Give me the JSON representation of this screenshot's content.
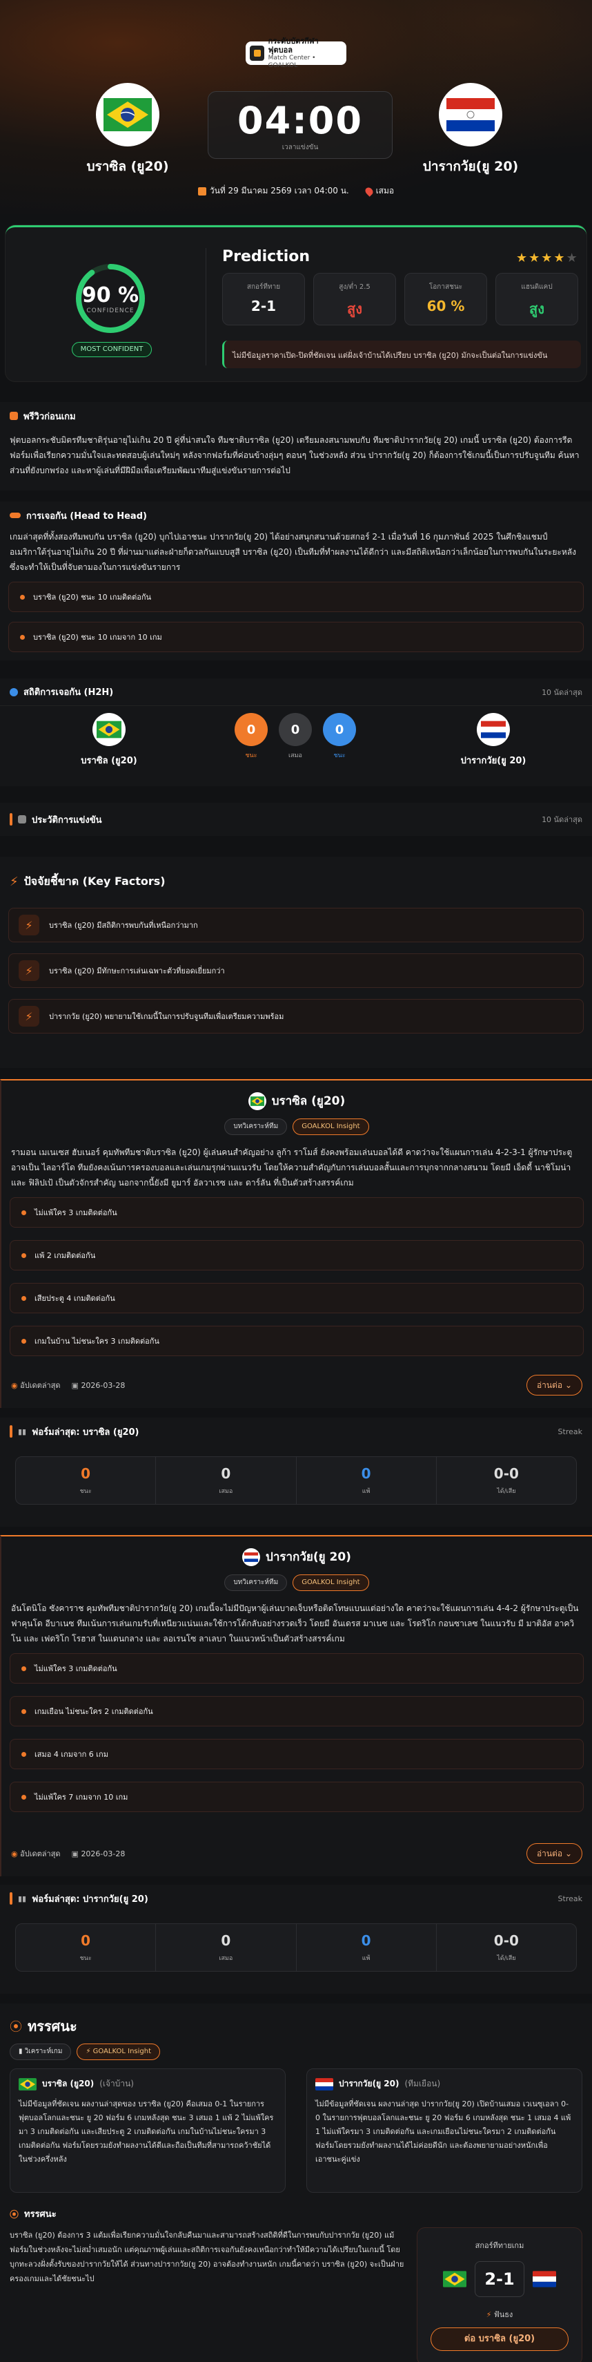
{
  "header": {
    "site_title": "กระดับบัตรกีฬาฟุตบอล",
    "site_subtitle": "Match Center • GOALKOL"
  },
  "match": {
    "home_team": "บราซิล (ยู20)",
    "away_team": "ปารากวัย(ยู 20)",
    "kickoff_time": "04:00",
    "time_label": "เวลาแข่งขัน",
    "date_text": "วันที่ 29 มีนาคม 2569 เวลา 04:00 น.",
    "venue_text": "เสมอ"
  },
  "prediction": {
    "confidence": "90 %",
    "confidence_value": 90,
    "confidence_label": "CONFIDENCE",
    "badge": "MOST CONFIDENT",
    "title": "Prediction",
    "stars": 4,
    "stars_max": 5,
    "cards": [
      {
        "label": "สกอร์ทีทาย",
        "value": "2-1",
        "color": "white"
      },
      {
        "label": "สูง/ต่ำ 2.5",
        "value": "สูง",
        "color": "red"
      },
      {
        "label": "โอกาสชนะ",
        "value": "60 %",
        "color": "gold"
      },
      {
        "label": "แฮนดิแคป",
        "value": "สูง",
        "color": "green"
      }
    ],
    "note": "ไม่มีข้อมูลราคาเปิด-ปิดที่ชัดเจน แต่ฝั่งเจ้าบ้านได้เปรียบ บราซิล (ยู20) มักจะเป็นต่อในการแข่งขัน"
  },
  "preview": {
    "title": "พรีวิวก่อนเกม",
    "text": "ฟุตบอลกระชับมิตรทีมชาติรุ่นอายุไม่เกิน 20 ปี คู่ที่น่าสนใจ ทีมชาติบราซิล (ยู20) เตรียมลงสนามพบกับ ทีมชาติปารากวัย(ยู 20) เกมนี้ บราซิล (ยู20) ต้องการรีดฟอร์มเพื่อเรียกความมั่นใจและทดสอบผู้เล่นใหม่ๆ หลังจากฟอร์มที่ค่อนข้างลุ่มๆ ดอนๆ ในช่วงหลัง ส่วน ปารากวัย(ยู 20) ก็ต้องการใช้เกมนี้เป็นการปรับจูนทีม ค้นหาส่วนที่ยังบกพร่อง และหาผู้เล่นที่มีฝีมือเพื่อเตรียมพัฒนาทีมสู่แข่งขันรายการต่อไป"
  },
  "h2h_text": {
    "title": "การเจอกัน (Head to Head)",
    "text": "เกมล่าสุดที่ทั้งสองทีมพบกัน บราซิล (ยู20) บุกไปเอาชนะ ปารากวัย(ยู 20) ได้อย่างสนุกสนานด้วยสกอร์ 2-1 เมื่อวันที่ 16 กุมภาพันธ์ 2025 ในศึกชิงแชมป์อเมริกาใต้รุ่นอายุไม่เกิน 20 ปี ที่ผ่านมาแต่ละฝ่ายก็ดวลกันแบบสูสี บราซิล (ยู20) เป็นทีมที่ทำผลงานได้ดีกว่า และมีสถิติเหนือกว่าเล็กน้อยในการพบกันในระยะหลัง ซึ่งจะทำให้เป็นที่จับตามองในการแข่งขันรายการ",
    "items": [
      "บราซิล (ยู20) ชนะ 10 เกมติดต่อกัน",
      "บราซิล (ยู20) ชนะ 10 เกมจาก 10 เกม"
    ]
  },
  "h2h_stats": {
    "title": "สถิติการเจอกัน (H2H)",
    "count_label": "10 นัดล่าสุด",
    "home_name": "บราซิล (ยู20)",
    "away_name": "ปารากวัย(ยู 20)",
    "circles": [
      {
        "value": "0",
        "label": "ชนะ"
      },
      {
        "value": "0",
        "label": "เสมอ"
      },
      {
        "value": "0",
        "label": "ชนะ"
      }
    ]
  },
  "history": {
    "title": "ประวัติการแข่งขัน",
    "count_label": "10 นัดล่าสุด"
  },
  "key_factors": {
    "title": "ปัจจัยชี้ขาด (Key Factors)",
    "items": [
      "บราซิล (ยู20) มีสถิติการพบกันที่เหนือกว่ามาก",
      "บราซิล (ยู20) มีทักษะการเล่นเฉพาะตัวที่ยอดเยี่ยมกว่า",
      "ปารากวัย (ยู20) พยายามใช้เกมนี้ในการปรับจูนทีมเพื่อเตรียมความพร้อม"
    ]
  },
  "home_analysis": {
    "name": "บราซิล (ยู20)",
    "pill_1": "บทวิเคราะห์ทีม",
    "pill_2": "GOALKOL Insight",
    "text": "รามอน เมเนเซส ฮับเนอร์ คุมทัพทีมชาติบราซิล (ยู20) ผู้เล่นคนสำคัญอย่าง ลูก้า ราโมส์ ยังคงพร้อมเล่นบอลได้ดี คาดว่าจะใช้แผนการเล่น 4-2-3-1 ผู้รักษาประตูอาจเป็น ไลอาร์โด ทีมยังคงเน้นการครองบอลและเล่นเกมรุกผ่านแนวรับ โดยให้ความสำคัญกับการเล่นบอลสั้นและการบุกจากกลางสนาม โดยมี เอ็ดดี้ นาชิโมน่า และ ฟิลิปเป้ เป็นตัวจักรสำคัญ นอกจากนี้ยังมี ยูมาร์ อัลวาเรซ และ ดาร์ลัน ที่เป็นตัวสร้างสรรค์เกม",
    "items": [
      "ไม่แพ้ใคร 3 เกมติดต่อกัน",
      "แพ้ 2 เกมติดต่อกัน",
      "เสียประตู 4 เกมติดต่อกัน",
      "เกมในบ้าน ไม่ชนะใคร 3 เกมติดต่อกัน"
    ],
    "updated_label": "อัปเดตล่าสุด",
    "updated_date": "2026-03-28",
    "readmore": "อ่านต่อ"
  },
  "home_form": {
    "title": "ฟอร์มล่าสุด: บราซิล (ยู20)",
    "right": "Streak",
    "cells": [
      {
        "value": "0",
        "label": "ชนะ"
      },
      {
        "value": "0",
        "label": "เสมอ"
      },
      {
        "value": "0",
        "label": "แพ้"
      },
      {
        "value": "0-0",
        "label": "ได้/เสีย"
      }
    ]
  },
  "away_analysis": {
    "name": "ปารากวัย(ยู 20)",
    "pill_1": "บทวิเคราะห์ทีม",
    "pill_2": "GOALKOL Insight",
    "text": "อันโตนิโอ ซังคาราช คุมทัพทีมชาติปารากวัย(ยู 20) เกมนี้จะไม่มีปัญหาผู้เล่นบาดเจ็บหรือติดโทษแบนแต่อย่างใด คาดว่าจะใช้แผนการเล่น 4-4-2 ผู้รักษาประตูเป็น ฟาคุนโด อีบาเนซ ทีมเน้นการเล่นเกมรับที่เหนียวแน่นและใช้การโต้กลับอย่างรวดเร็ว โดยมี อันเดรส มาเนซ และ โรดริโก กอนซาเลซ ในแนวรับ มี มาติอัส อาควิโน และ เฟดริโก โรฮาส ในแดนกลาง และ ลอเรนโซ ลาเลบา ในแนวหน้าเป็นตัวสร้างสรรค์เกม",
    "items": [
      "ไม่แพ้ใคร 3 เกมติดต่อกัน",
      "เกมเยือน ไม่ชนะใคร 2 เกมติดต่อกัน",
      "เสมอ 4 เกมจาก 6 เกม",
      "ไม่แพ้ใคร 7 เกมจาก 10 เกม"
    ],
    "updated_label": "อัปเดตล่าสุด",
    "updated_date": "2026-03-28",
    "readmore": "อ่านต่อ"
  },
  "away_form": {
    "title": "ฟอร์มล่าสุด: ปารากวัย(ยู 20)",
    "right": "Streak",
    "cells": [
      {
        "value": "0",
        "label": "ชนะ"
      },
      {
        "value": "0",
        "label": "เสมอ"
      },
      {
        "value": "0",
        "label": "แพ้"
      },
      {
        "value": "0-0",
        "label": "ได้/เสีย"
      }
    ]
  },
  "analysis": {
    "title": "ทรรศนะ",
    "pill_1": "วิเคราะห์เกม",
    "pill_2": "GOALKOL Insight",
    "home_head": "บราซิล (ยู20)",
    "home_sub": "(เจ้าบ้าน)",
    "home_text": "ไม่มีข้อมูลที่ชัดเจน ผลงานล่าสุดของ บราซิล (ยู20) คือเสมอ 0-1 ในรายการฟุตบอลโลกและชนะ ยู 20 ฟอร์ม 6 เกมหลังสุด ชนะ 3 เสมอ 1 แพ้ 2 ไม่แพ้ใครมา 3 เกมติดต่อกัน และเสียประตู 2 เกมติดต่อกัน เกมในบ้านไม่ชนะใครมา 3 เกมติดต่อกัน ฟอร์มโดยรวมยังทำผลงานได้ดีและถือเป็นทีมที่สามารถคว้าชัยได้ในช่วงครึ่งหลัง",
    "away_head": "ปารากวัย(ยู 20)",
    "away_sub": "(ทีมเยือน)",
    "away_text": "ไม่มีข้อมูลที่ชัดเจน ผลงานล่าสุด ปารากวัย(ยู 20) เปิดบ้านเสมอ เวเนซุเอลา 0-0 ในรายการฟุตบอลโลกและชนะ ยู 20 ฟอร์ม 6 เกมหลังสุด ชนะ 1 เสมอ 4 แพ้ 1 ไม่แพ้ใครมา 3 เกมติดต่อกัน และเกมเยือนไม่ชนะใครมา 2 เกมติดต่อกัน ฟอร์มโดยรวมยังทำผลงานได้ไม่ค่อยดีนัก และต้องพยายามอย่างหนักเพื่อเอาชนะคู่แข่ง",
    "summary_title": "ทรรศนะ",
    "summary_text": "บราซิล (ยู20) ต้องการ 3 แต้มเพื่อเรียกความมั่นใจกลับคืนมาและสามารถสร้างสถิติที่ดีในการพบกับปารากวัย (ยู20) แม้ฟอร์มในช่วงหลังจะไม่สม่ำเสมอนัก แต่คุณภาพผู้เล่นและสถิติการเจอกันยังคงเหนือกว่าทำให้มีความได้เปรียบในเกมนี้ โดยบุกทะลวงฝั่งตั้งรับของปารากวัยให้ได้ ส่วนทางปารากวัย(ยู 20) อาจต้องทำงานหนัก เกมนี้คาดว่า บราซิล (ยู20) จะเป็นฝ่ายครองเกมและได้ชัยชนะไป",
    "side_label": "สกอร์ทีทายเกม",
    "side_score": "2-1",
    "side_pick_label": "ฟันธง",
    "side_pick": "ต่อ บราซิล (ยู20)"
  },
  "colors": {
    "accent": "#f07a2a",
    "green": "#2ecc71",
    "red": "#e8483b",
    "gold": "#f5b82e",
    "blue": "#3b8ee8"
  }
}
